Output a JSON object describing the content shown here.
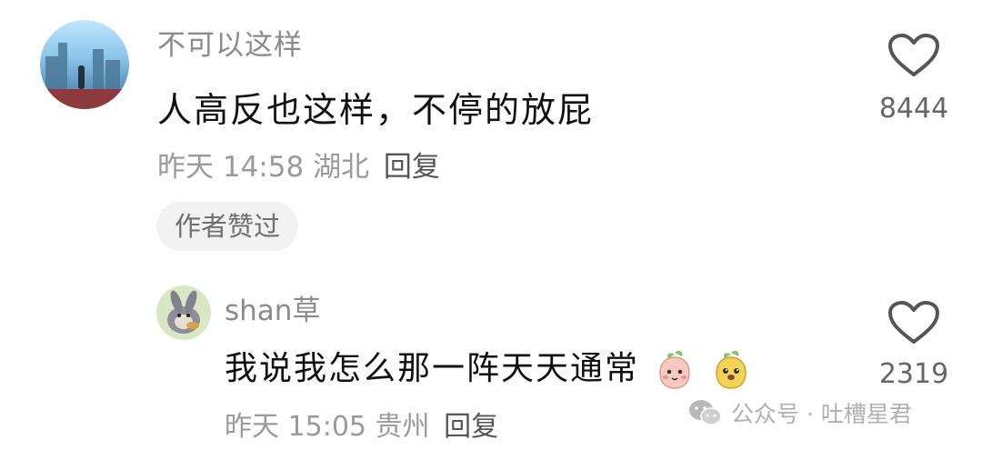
{
  "comment": {
    "username": "不可以这样",
    "text": "人高反也这样，不停的放屁",
    "time": "昨天 14:58",
    "location": "湖北",
    "reply_label": "回复",
    "author_liked_tag": "作者赞过",
    "likes": "8444",
    "like_icon": "heart-outline-icon"
  },
  "reply": {
    "username": "shan草",
    "text": "我说我怎么那一阵天天通常",
    "emojis": [
      "pink-face-emoji",
      "yellow-face-emoji"
    ],
    "time": "昨天 15:05",
    "location": "贵州",
    "reply_label": "回复",
    "likes": "2319",
    "like_icon": "heart-outline-icon"
  },
  "watermark": {
    "icon": "wechat-icon",
    "text": "公众号 · 吐槽星君"
  },
  "colors": {
    "username": "#8b8b8b",
    "body_text": "#111111",
    "meta_text": "#9a9a9a",
    "tag_bg": "#f2f2f2"
  }
}
